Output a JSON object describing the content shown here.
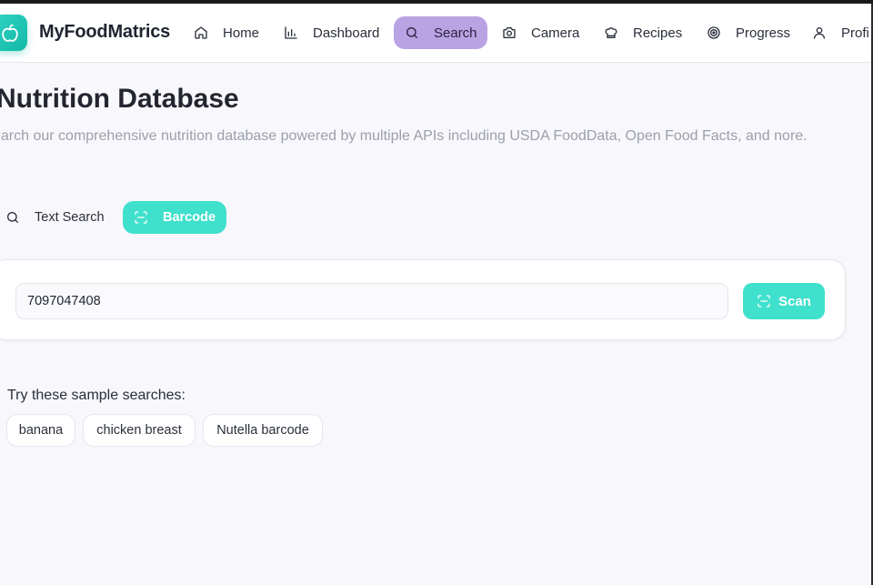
{
  "brand": {
    "name": "MyFoodMatrics"
  },
  "nav": {
    "items": [
      {
        "label": "Home",
        "icon": "home-icon"
      },
      {
        "label": "Dashboard",
        "icon": "bar-chart-icon"
      },
      {
        "label": "Search",
        "icon": "search-icon",
        "active": true
      },
      {
        "label": "Camera",
        "icon": "camera-icon"
      },
      {
        "label": "Recipes",
        "icon": "chef-hat-icon"
      },
      {
        "label": "Progress",
        "icon": "target-icon"
      },
      {
        "label": "Profi",
        "icon": "user-icon"
      }
    ]
  },
  "page": {
    "title": "Nutrition Database",
    "description": "earch our comprehensive nutrition database powered by multiple APIs including USDA FoodData, Open Food Facts, and nore."
  },
  "mode_tabs": {
    "text_search": "Text Search",
    "barcode": "Barcode"
  },
  "search": {
    "value": "7097047408",
    "scan_label": "Scan"
  },
  "samples": {
    "label": "Try these sample searches:",
    "items": [
      "banana",
      "chicken breast",
      "Nutella barcode"
    ]
  },
  "colors": {
    "accent_teal": "#3fe0cc",
    "active_nav": "#b9a3e3",
    "background": "#f8f7fc"
  }
}
